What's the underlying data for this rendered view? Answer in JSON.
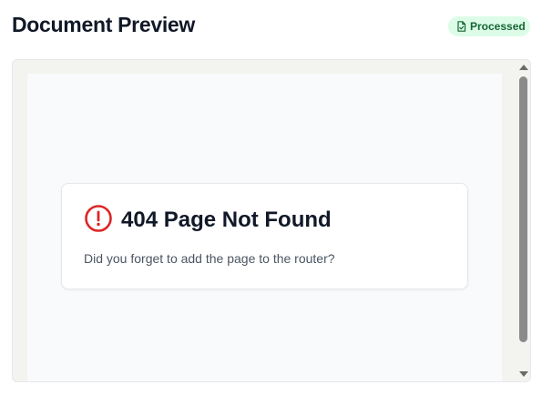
{
  "header": {
    "title": "Document Preview",
    "status_badge": {
      "label": "Processed",
      "icon": "file-check-icon",
      "bg_color": "#dcfce7",
      "text_color": "#166534"
    }
  },
  "preview": {
    "error": {
      "icon": "alert-circle-icon",
      "icon_color": "#dc2626",
      "title": "404 Page Not Found",
      "message": "Did you forget to add the page to the router?"
    }
  }
}
